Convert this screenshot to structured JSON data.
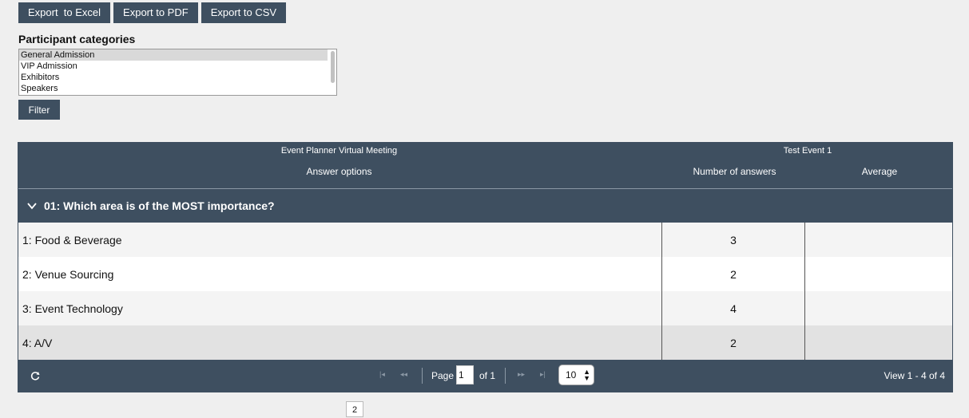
{
  "toolbar": {
    "export_excel": "Export  to Excel",
    "export_pdf": "Export to PDF",
    "export_csv": "Export to CSV"
  },
  "categories": {
    "title": "Participant categories",
    "options": [
      "General Admission",
      "VIP Admission",
      "Exhibitors",
      "Speakers"
    ],
    "selected": "General Admission"
  },
  "filter": {
    "label": "Filter"
  },
  "grid": {
    "group_headers": [
      "Event Planner Virtual Meeting",
      "Test Event 1"
    ],
    "columns": [
      "Answer options",
      "Number of answers",
      "Average"
    ],
    "question": "01: Which area is of the MOST importance?",
    "rows": [
      {
        "option": "1: Food & Beverage",
        "count": "3",
        "average": ""
      },
      {
        "option": "2: Venue Sourcing",
        "count": "2",
        "average": ""
      },
      {
        "option": "3: Event Technology",
        "count": "4",
        "average": ""
      },
      {
        "option": "4: A/V",
        "count": "2",
        "average": ""
      }
    ]
  },
  "pager": {
    "first_icon": "first-page-icon",
    "prev_icon": "prev-page-icon",
    "next_icon": "next-page-icon",
    "last_icon": "last-page-icon",
    "page_label": "Page",
    "page_value": "1",
    "of_label": "of 1",
    "rows_per_page": "10",
    "view_info": "View 1 - 4 of 4"
  },
  "tooltip": {
    "text": "2"
  },
  "colors": {
    "header": "#3e4f60",
    "background": "#efefef"
  }
}
